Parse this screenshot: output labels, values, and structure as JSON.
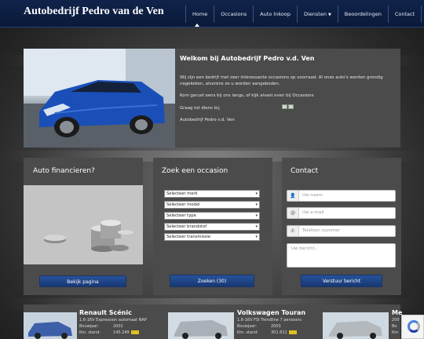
{
  "brand": "Autobedrijf Pedro van de Ven",
  "nav": {
    "items": [
      "Home",
      "Occasions",
      "Auto Inkoop",
      "Diensten",
      "Beoordelingen",
      "Contact"
    ],
    "active": "Home"
  },
  "welcome": {
    "title": "Welkom bij Autobedrijf Pedro v.d. Ven",
    "p1": "Wij zijn een bedrijf met zeer interessante occasions op voorraad. Al onze auto's worden grondig nagekeken, alvorens ze u worden aangeboden.",
    "p2": "Kom gerust eens bij ons langs, of kijk alvast even bij Occasions",
    "p3": "Graag tot diens bij,",
    "p4": "Autobedrijf Pedro v.d. Ven"
  },
  "financing": {
    "title": "Auto financieren?",
    "button": "Bekijk pagina"
  },
  "search": {
    "title": "Zoek een occasion",
    "selects": [
      "Selecteer merk",
      "Selecteer model",
      "Selecteer type",
      "Selecteer brandstof",
      "Selecteer transmissie"
    ],
    "button": "Zoeken (30)"
  },
  "contact": {
    "title": "Contact",
    "name_placeholder": "Uw naam",
    "email_placeholder": "Uw e-mail",
    "phone_placeholder": "Telefoon nummer",
    "message_placeholder": "Uw bericht..",
    "button": "Verstuur bericht"
  },
  "occasions": [
    {
      "title": "Renault Scénic",
      "sub": "1.6-16V Expression automaat NAP",
      "year_label": "Bouwjaar:",
      "year": "2001",
      "km_label": "Km. stand:",
      "km": "145.249"
    },
    {
      "title": "Volkswagen Touran",
      "sub": "1.6-16V FSI Trendline 7 persoons",
      "year_label": "Bouwjaar:",
      "year": "2003",
      "km_label": "Km. stand:",
      "km": "301.611"
    },
    {
      "title": "Me",
      "sub": "200",
      "year_label": "Bo",
      "year": "",
      "km_label": "Km",
      "km": ""
    }
  ],
  "colors": {
    "navbar": "#0e2147",
    "panel": "#4b4b4b",
    "button": "#1f4689",
    "car_blue": "#1a4fb8"
  }
}
